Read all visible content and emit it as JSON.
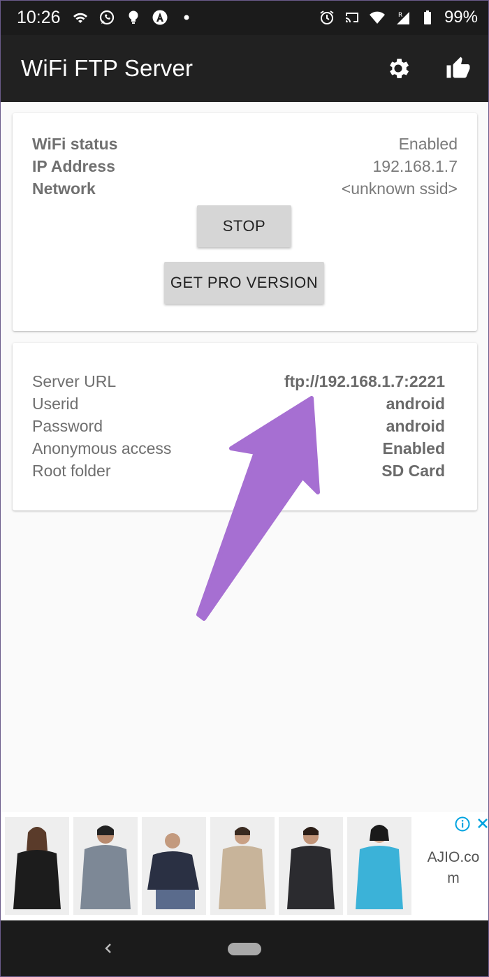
{
  "status_bar": {
    "time": "10:26",
    "battery_percent": "99%",
    "left_icons": [
      "wifi-icon",
      "whatsapp-icon",
      "bulb-icon",
      "android-a-icon",
      "dot-icon"
    ],
    "right_icons": [
      "alarm-icon",
      "cast-icon",
      "signal-wifi-icon",
      "roaming-signal-icon",
      "battery-icon"
    ]
  },
  "app_bar": {
    "title": "WiFi FTP Server",
    "actions": [
      "settings-gear-icon",
      "thumbs-up-icon"
    ]
  },
  "status_card": {
    "rows": [
      {
        "label": "WiFi status",
        "value": "Enabled"
      },
      {
        "label": "IP Address",
        "value": "192.168.1.7"
      },
      {
        "label": "Network",
        "value": "<unknown ssid>"
      }
    ],
    "stop_button": "STOP",
    "pro_button": "GET PRO VERSION"
  },
  "server_card": {
    "rows": [
      {
        "label": "Server URL",
        "value": "ftp://192.168.1.7:2221"
      },
      {
        "label": "Userid",
        "value": "android"
      },
      {
        "label": "Password",
        "value": "android"
      },
      {
        "label": "Anonymous access",
        "value": "Enabled"
      },
      {
        "label": "Root folder",
        "value": "SD Card"
      }
    ]
  },
  "ad": {
    "advertiser_line1": "AJIO.co",
    "advertiser_line2": "m",
    "jacket_colors": [
      "#1c1c1c",
      "#7d8896",
      "#2a3043",
      "#c8b49a",
      "#2b2b2f",
      "#3bb2d8"
    ],
    "icons": [
      "info-icon",
      "close-icon"
    ]
  },
  "colors": {
    "arrow": "#a66fd2",
    "app_bar": "#212121",
    "status_bar": "#1b1b1b"
  }
}
